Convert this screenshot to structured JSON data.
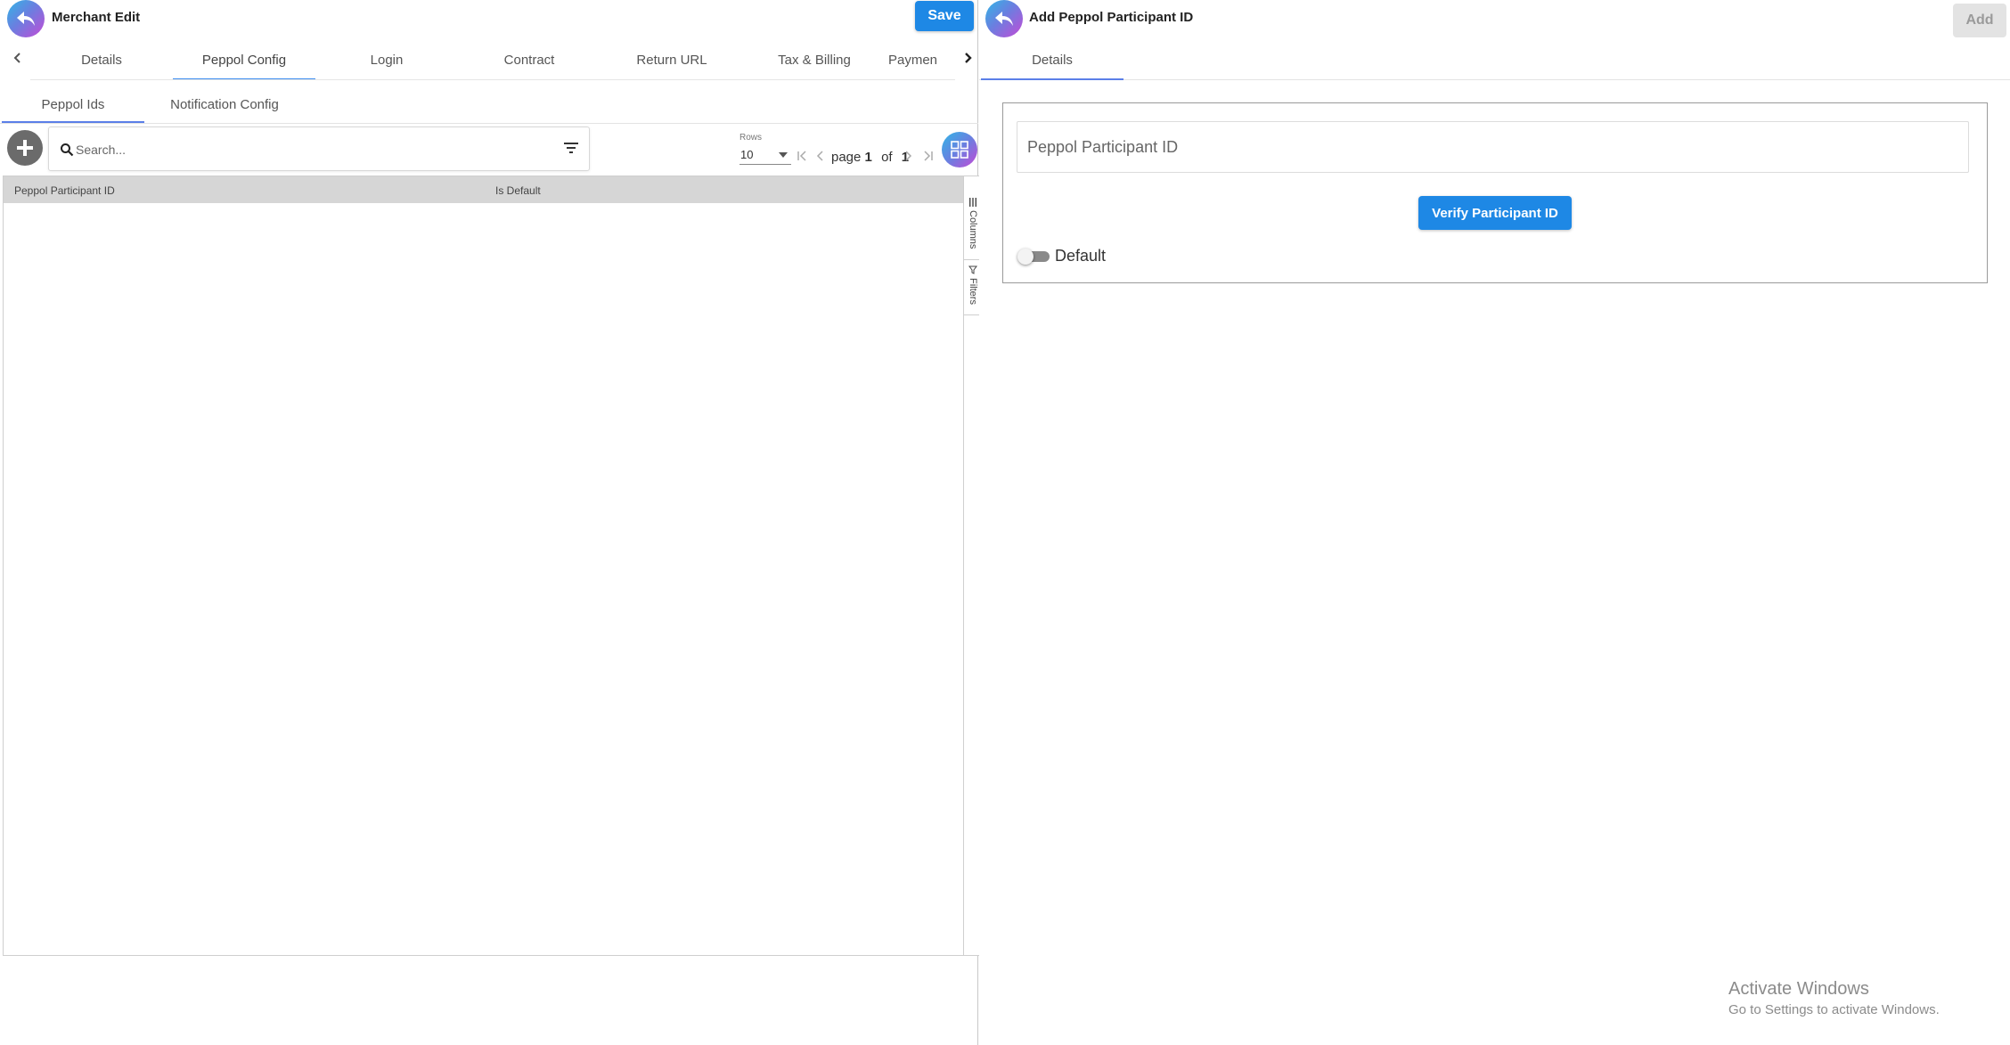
{
  "left": {
    "title": "Merchant Edit",
    "save_label": "Save",
    "tabs": [
      {
        "label": "Details"
      },
      {
        "label": "Peppol Config",
        "active": true
      },
      {
        "label": "Login"
      },
      {
        "label": "Contract"
      },
      {
        "label": "Return URL"
      },
      {
        "label": "Tax & Billing"
      },
      {
        "label": "Paymen"
      }
    ],
    "subtabs": [
      {
        "label": "Peppol Ids",
        "active": true
      },
      {
        "label": "Notification Config"
      }
    ],
    "search": {
      "placeholder": "Search..."
    },
    "rows": {
      "label": "Rows",
      "value": "10"
    },
    "pager": {
      "page_word": "page",
      "page": "1",
      "of_word": "of",
      "total": "1"
    },
    "grid": {
      "columns": [
        "Peppol Participant ID",
        "Is Default"
      ],
      "rows": []
    },
    "side_tabs": [
      "Columns",
      "Filters"
    ]
  },
  "right": {
    "title": "Add Peppol Participant ID",
    "add_label": "Add",
    "tabs": [
      {
        "label": "Details",
        "active": true
      }
    ],
    "participant_input": {
      "placeholder": "Peppol Participant ID",
      "value": ""
    },
    "verify_label": "Verify Participant ID",
    "default_toggle": {
      "label": "Default",
      "on": false
    }
  },
  "watermark": {
    "title": "Activate Windows",
    "subtitle": "Go to Settings to activate Windows."
  },
  "colors": {
    "primary": "#1e88e5",
    "tab_underline": "#3b8cf0",
    "grid_header": "#d6d6d6"
  }
}
